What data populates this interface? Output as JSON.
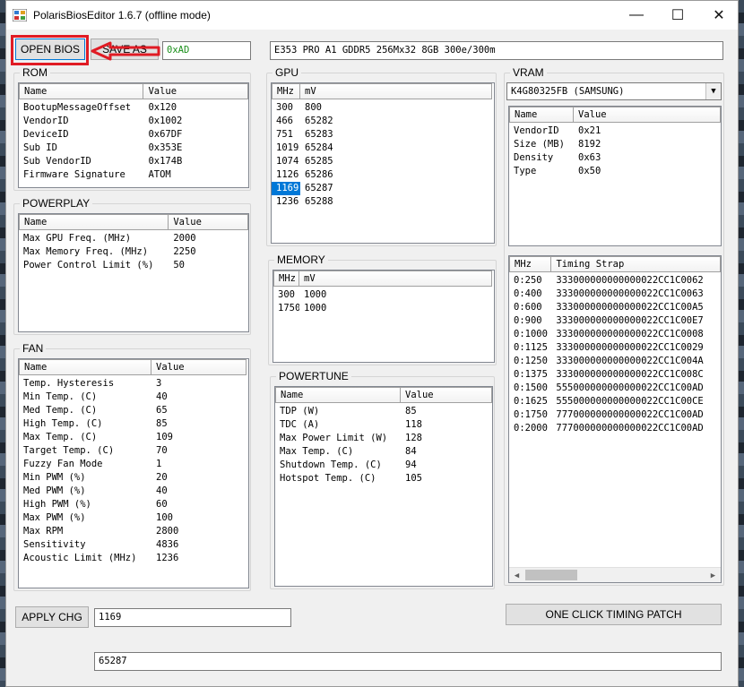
{
  "window": {
    "title": "PolarisBiosEditor 1.6.7 (offline mode)",
    "minimize": "—",
    "maximize": "☐",
    "close": "✕"
  },
  "toolbar": {
    "open_bios": "OPEN BIOS",
    "save_as": "SAVE AS",
    "checksum": "0xAD",
    "bios_info": "E353 PRO A1 GDDR5 256Mx32 8GB 300e/300m"
  },
  "rom": {
    "label": "ROM",
    "columns": [
      "Name",
      "Value"
    ],
    "rows": [
      [
        "BootupMessageOffset",
        "0x120"
      ],
      [
        "VendorID",
        "0x1002"
      ],
      [
        "DeviceID",
        "0x67DF"
      ],
      [
        "Sub ID",
        "0x353E"
      ],
      [
        "Sub VendorID",
        "0x174B"
      ],
      [
        "Firmware Signature",
        "ATOM"
      ]
    ]
  },
  "powerplay": {
    "label": "POWERPLAY",
    "columns": [
      "Name",
      "Value"
    ],
    "rows": [
      [
        "Max GPU Freq. (MHz)",
        "2000"
      ],
      [
        "Max Memory Freq. (MHz)",
        "2250"
      ],
      [
        "Power Control Limit (%)",
        "50"
      ]
    ]
  },
  "fan": {
    "label": "FAN",
    "columns": [
      "Name",
      "Value"
    ],
    "rows": [
      [
        "Temp. Hysteresis",
        "3"
      ],
      [
        "Min Temp. (C)",
        "40"
      ],
      [
        "Med Temp. (C)",
        "65"
      ],
      [
        "High Temp. (C)",
        "85"
      ],
      [
        "Max Temp. (C)",
        "109"
      ],
      [
        "Target Temp. (C)",
        "70"
      ],
      [
        "Fuzzy Fan Mode",
        "1"
      ],
      [
        "Min PWM (%)",
        "20"
      ],
      [
        "Med PWM (%)",
        "40"
      ],
      [
        "High PWM (%)",
        "60"
      ],
      [
        "Max PWM (%)",
        "100"
      ],
      [
        "Max RPM",
        "2800"
      ],
      [
        "Sensitivity",
        "4836"
      ],
      [
        "Acoustic Limit (MHz)",
        "1236"
      ]
    ]
  },
  "gpu": {
    "label": "GPU",
    "columns": [
      "MHz",
      "mV"
    ],
    "selected_index": 6,
    "rows": [
      [
        "300",
        "800"
      ],
      [
        "466",
        "65282"
      ],
      [
        "751",
        "65283"
      ],
      [
        "1019",
        "65284"
      ],
      [
        "1074",
        "65285"
      ],
      [
        "1126",
        "65286"
      ],
      [
        "1169",
        "65287"
      ],
      [
        "1236",
        "65288"
      ]
    ]
  },
  "memory": {
    "label": "MEMORY",
    "columns": [
      "MHz",
      "mV"
    ],
    "rows": [
      [
        "300",
        "1000"
      ],
      [
        "1750",
        "1000"
      ]
    ]
  },
  "powertune": {
    "label": "POWERTUNE",
    "columns": [
      "Name",
      "Value"
    ],
    "rows": [
      [
        "TDP (W)",
        "85"
      ],
      [
        "TDC (A)",
        "118"
      ],
      [
        "Max Power Limit (W)",
        "128"
      ],
      [
        "Max Temp. (C)",
        "84"
      ],
      [
        "Shutdown Temp. (C)",
        "94"
      ],
      [
        "Hotspot Temp. (C)",
        "105"
      ]
    ]
  },
  "vram": {
    "label": "VRAM",
    "selected_chip": "K4G80325FB (SAMSUNG)",
    "columns": [
      "Name",
      "Value"
    ],
    "rows": [
      [
        "VendorID",
        "0x21"
      ],
      [
        "Size (MB)",
        "8192"
      ],
      [
        "Density",
        "0x63"
      ],
      [
        "Type",
        "0x50"
      ]
    ]
  },
  "timing": {
    "columns": [
      "MHz",
      "Timing Strap"
    ],
    "rows": [
      [
        "0:250",
        "333000000000000022CC1C0062"
      ],
      [
        "0:400",
        "333000000000000022CC1C0063"
      ],
      [
        "0:600",
        "333000000000000022CC1C00A5"
      ],
      [
        "0:900",
        "333000000000000022CC1C00E7"
      ],
      [
        "0:1000",
        "333000000000000022CC1C0008"
      ],
      [
        "0:1125",
        "333000000000000022CC1C0029"
      ],
      [
        "0:1250",
        "333000000000000022CC1C004A"
      ],
      [
        "0:1375",
        "333000000000000022CC1C008C"
      ],
      [
        "0:1500",
        "555000000000000022CC1C00AD"
      ],
      [
        "0:1625",
        "555000000000000022CC1C00CE"
      ],
      [
        "0:1750",
        "777000000000000022CC1C00AD"
      ],
      [
        "0:2000",
        "777000000000000022CC1C00AD"
      ]
    ]
  },
  "bottom": {
    "apply_chg": "APPLY CHG",
    "edit_value": "1169",
    "one_click": "ONE CLICK TIMING PATCH",
    "edit_value2": "65287"
  },
  "colors": {
    "annotation_red": "#e01b24",
    "selection_blue": "#0078d7",
    "checksum_green": "#1a8f1a"
  }
}
